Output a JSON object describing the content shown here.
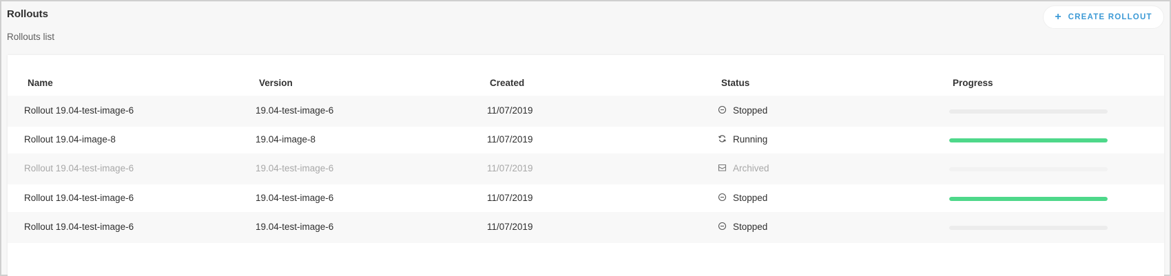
{
  "header": {
    "title": "Rollouts",
    "subtitle": "Rollouts list",
    "create_button": {
      "icon": "plus-icon",
      "label": "CREATE ROLLOUT"
    }
  },
  "table": {
    "columns": [
      "Name",
      "Version",
      "Created",
      "Status",
      "Progress"
    ],
    "rows": [
      {
        "name": "Rollout 19.04-test-image-6",
        "version": "19.04-test-image-6",
        "created": "11/07/2019",
        "status": "Stopped",
        "status_icon": "stopped-circle-icon",
        "progress": 0
      },
      {
        "name": "Rollout 19.04-image-8",
        "version": "19.04-image-8",
        "created": "11/07/2019",
        "status": "Running",
        "status_icon": "refresh-icon",
        "progress": 1.0
      },
      {
        "name": "Rollout 19.04-test-image-6",
        "version": "19.04-test-image-6",
        "created": "11/07/2019",
        "status": "Archived",
        "status_icon": "archive-box-icon",
        "progress": 0
      },
      {
        "name": "Rollout 19.04-test-image-6",
        "version": "19.04-test-image-6",
        "created": "11/07/2019",
        "status": "Stopped",
        "status_icon": "stopped-circle-icon",
        "progress": 1.0
      },
      {
        "name": "Rollout 19.04-test-image-6",
        "version": "19.04-test-image-6",
        "created": "11/07/2019",
        "status": "Stopped",
        "status_icon": "stopped-circle-icon",
        "progress": 0
      }
    ]
  },
  "colors": {
    "accent": "#3c9ad6",
    "progress_fill": "#4ed88a",
    "archived_text": "#a8a8a8"
  }
}
